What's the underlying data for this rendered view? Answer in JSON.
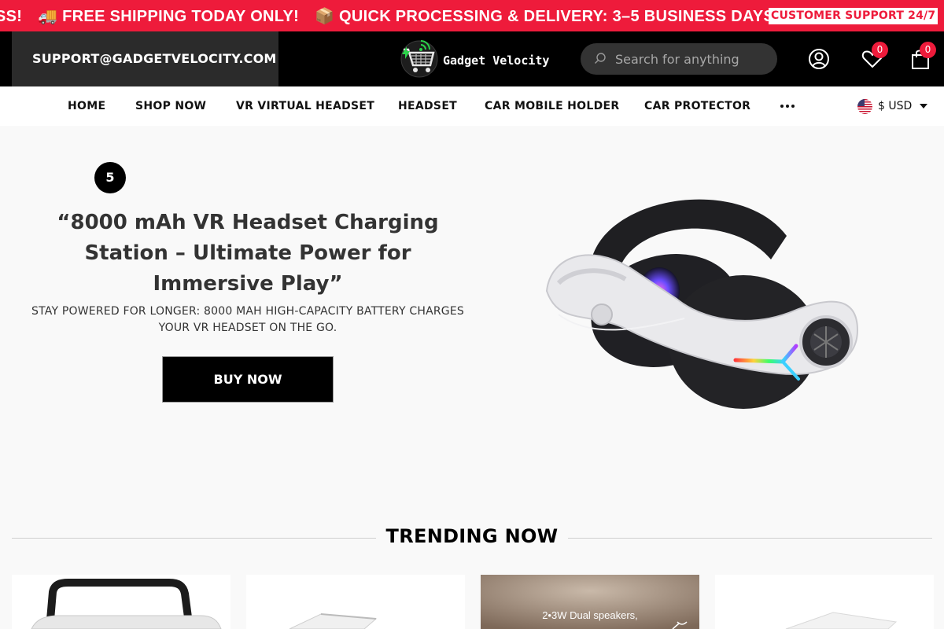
{
  "announcement": {
    "ticker_items": [
      "SS!",
      "🚚 FREE SHIPPING TODAY ONLY!",
      "📦 QUICK PROCESSING & DELIVERY: 3–5 BUSINESS DAYS!"
    ],
    "support_badge": "CUSTOMER SUPPORT 24/7"
  },
  "header": {
    "email": "SUPPORT@GADGETVELOCITY.COM",
    "brand": "Gadget Velocity",
    "search_placeholder": "Search for anything",
    "wishlist_count": "0",
    "cart_count": "0"
  },
  "nav": {
    "items": [
      "HOME",
      "SHOP NOW",
      "VR VIRTUAL HEADSET",
      "HEADSET",
      "CAR MOBILE HOLDER",
      "CAR PROTECTOR"
    ],
    "currency": "$ USD"
  },
  "hero": {
    "slide_number": "5",
    "title": "“8000 mAh VR Headset Charging Station – Ultimate Power for Immersive Play”",
    "subtitle": "Stay powered for longer: 8000 mAh high-capacity battery charges your VR headset on the go.",
    "button": "BUY NOW"
  },
  "trending": {
    "title": "TRENDING NOW",
    "card_caption": "2•3W Dual speakers,"
  },
  "colors": {
    "accent": "#ee1b3b",
    "header_bg": "#000000",
    "page_bg": "#f9f9f9"
  },
  "icons": [
    "truck-icon",
    "package-icon",
    "search-icon",
    "account-icon",
    "heart-icon",
    "bag-icon",
    "more-icon",
    "us-flag-icon",
    "caret-down-icon"
  ]
}
